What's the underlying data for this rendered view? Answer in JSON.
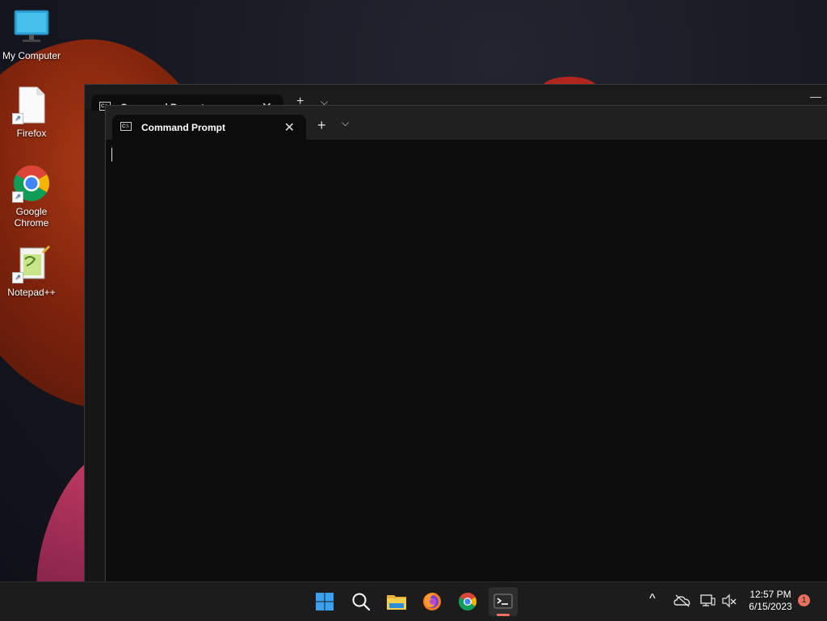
{
  "desktop": {
    "icons": [
      {
        "label": "My Computer",
        "icon": "monitor-icon"
      },
      {
        "label": "Firefox",
        "icon": "blank-file-icon"
      },
      {
        "label": "Google\nChrome",
        "icon": "chrome-icon"
      },
      {
        "label": "Notepad++",
        "icon": "notepad-plus-plus-icon"
      }
    ]
  },
  "windows": {
    "back": {
      "tab_title": "Command Prompt",
      "tab_close": "✕",
      "new_tab": "+",
      "menu": "⌵",
      "minimize": "—"
    },
    "front": {
      "tab_title": "Command Prompt",
      "tab_close": "✕",
      "new_tab": "+",
      "menu": "⌵"
    }
  },
  "taskbar": {
    "apps": [
      "start-icon",
      "search-icon",
      "file-explorer-icon",
      "firefox-icon",
      "chrome-icon",
      "terminal-icon"
    ],
    "active_app": "terminal-icon",
    "tray": {
      "chevron": "^",
      "time": "12:57 PM",
      "date": "6/15/2023",
      "notification_count": "1"
    }
  },
  "colors": {
    "accent": "#f27266",
    "terminal_bg": "#0c0c0c",
    "taskbar_bg": "#1c1c1c"
  }
}
